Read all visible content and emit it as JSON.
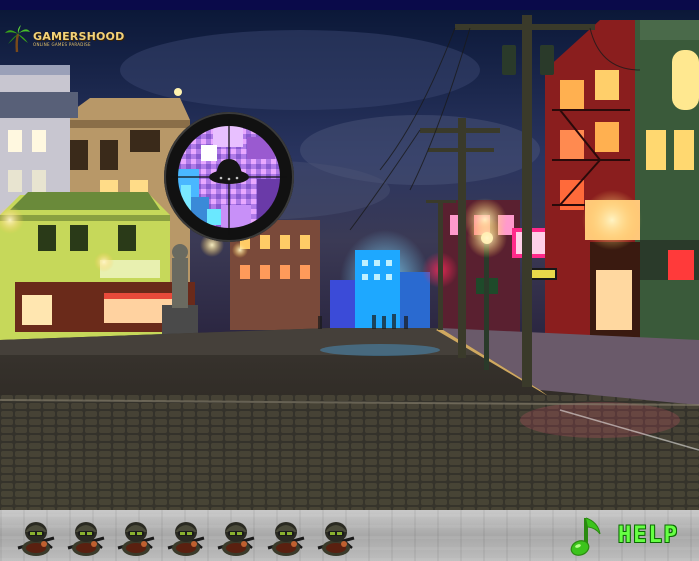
{
  "game": {
    "logo": {
      "name": "GAMERSHOOD",
      "tagline": "online games paradise"
    },
    "scope": {
      "icon": "ufo-target-icon"
    },
    "lives": {
      "count": 7,
      "icon": "soldier-helmet-icon"
    },
    "controls": {
      "music_icon": "music-note-icon",
      "help_label": "HELP"
    }
  },
  "colors": {
    "top_bar": "#0a0a4a",
    "help_green": "#66ff44",
    "music_green": "#3cc41c",
    "scope_ring": "#111111"
  }
}
